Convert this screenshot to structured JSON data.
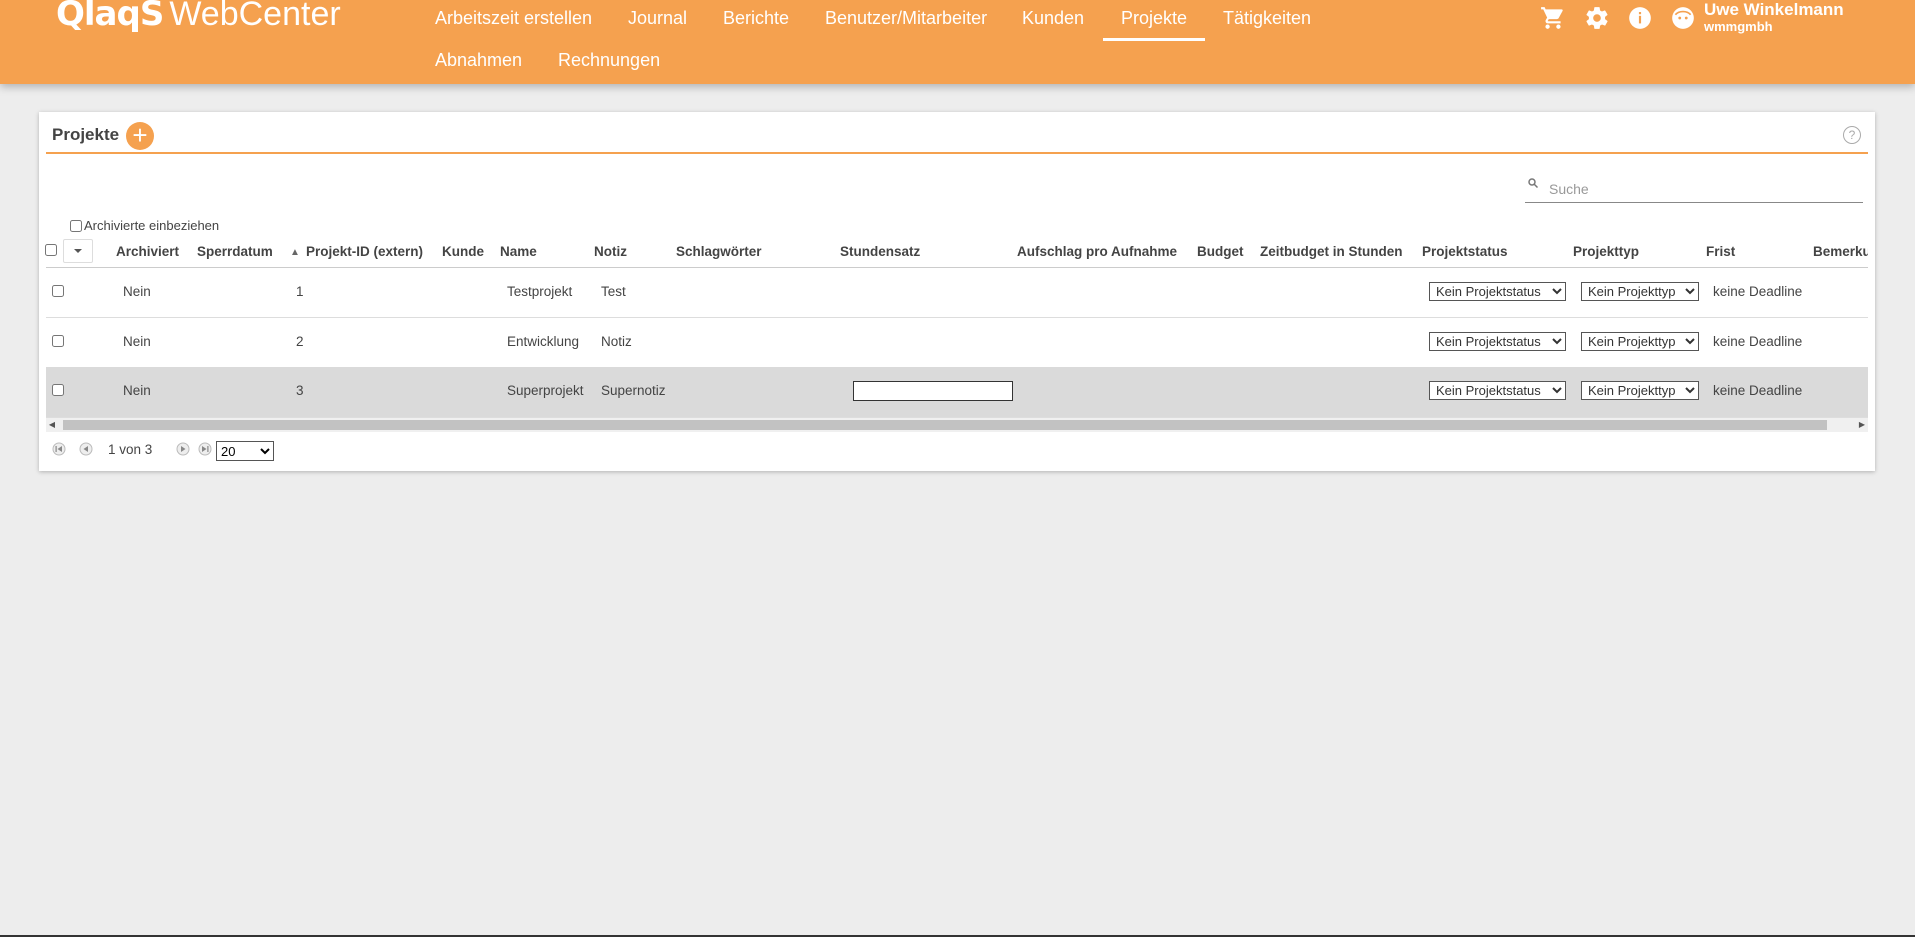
{
  "app": {
    "brand": "QlaqS",
    "product": "WebCenter"
  },
  "nav": {
    "items": [
      {
        "label": "Arbeitszeit erstellen"
      },
      {
        "label": "Journal"
      },
      {
        "label": "Berichte"
      },
      {
        "label": "Benutzer/Mitarbeiter"
      },
      {
        "label": "Kunden"
      },
      {
        "label": "Projekte",
        "active": true
      },
      {
        "label": "Tätigkeiten"
      },
      {
        "label": "Abnahmen"
      },
      {
        "label": "Rechnungen"
      }
    ]
  },
  "header_icons": [
    "cart-icon",
    "gear-icon",
    "info-icon",
    "user-face-icon"
  ],
  "user": {
    "name": "Uwe Winkelmann",
    "company": "wmmgmbh"
  },
  "panel": {
    "title": "Projekte",
    "add_symbol": "+",
    "help_symbol": "?",
    "search_placeholder": "Suche",
    "archived_label": "Archivierte einbeziehen"
  },
  "table": {
    "columns": [
      "Archiviert",
      "Sperrdatum",
      "Projekt-ID (extern)",
      "Kunde",
      "Name",
      "Notiz",
      "Schlagwörter",
      "Stundensatz",
      "Aufschlag pro Aufnahme",
      "Budget",
      "Zeitbudget in Stunden",
      "Projektstatus",
      "Projekttyp",
      "Frist",
      "Bemerkungen"
    ],
    "rows": [
      {
        "archiviert": "Nein",
        "id": "1",
        "name": "Testprojekt",
        "notiz": "Test",
        "status": "Kein Projektstatus",
        "typ": "Kein Projekttyp",
        "frist": "keine Deadline"
      },
      {
        "archiviert": "Nein",
        "id": "2",
        "name": "Entwicklung",
        "notiz": "Notiz",
        "status": "Kein Projektstatus",
        "typ": "Kein Projekttyp",
        "frist": "keine Deadline"
      },
      {
        "archiviert": "Nein",
        "id": "3",
        "name": "Superprojekt",
        "notiz": "Supernotiz",
        "status": "Kein Projektstatus",
        "typ": "Kein Projekttyp",
        "frist": "keine Deadline",
        "selected": true,
        "stundensatz_value": ""
      }
    ]
  },
  "pager": {
    "info": "1 von 3",
    "page_size": "20",
    "page_size_options": [
      "20"
    ]
  },
  "colors": {
    "accent": "#f5a14f",
    "background": "#ededed",
    "selected_row": "#dadada"
  }
}
